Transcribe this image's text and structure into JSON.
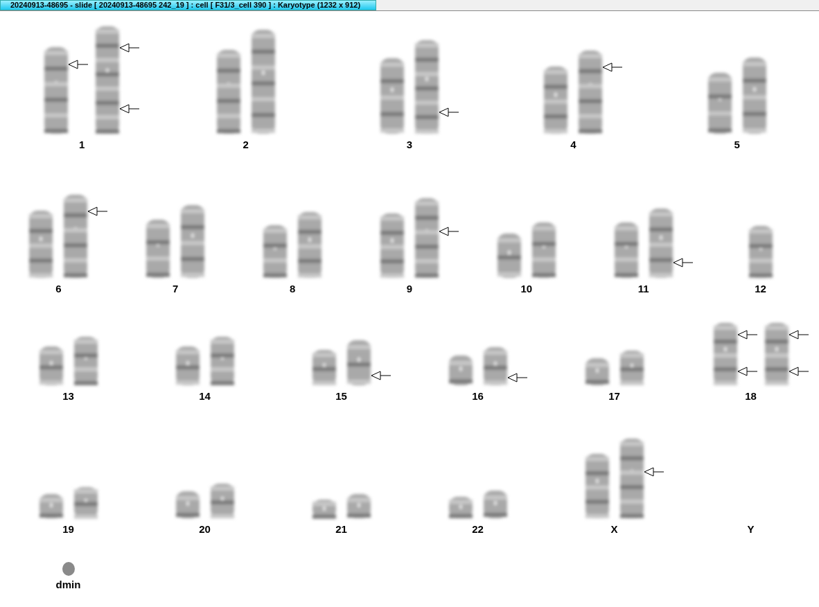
{
  "title_bar": {
    "title": "20240913-48695 - slide [ 20240913-48695 242_19 ] : cell [ F31/3_cell 390 ] : Karyotype  (1232 x 912)"
  },
  "rows": [
    {
      "groups": [
        {
          "label": "1",
          "chromosomes": [
            {
              "kind": "chromosome",
              "arrow_p": true,
              "arrow_cen": false,
              "arrow_q": false
            },
            {
              "kind": "chromosome",
              "arrow_p": true,
              "arrow_cen": false,
              "arrow_q": true
            }
          ]
        },
        {
          "label": "2",
          "chromosomes": [
            {
              "kind": "chromosome",
              "arrow_p": false,
              "arrow_cen": false,
              "arrow_q": false
            },
            {
              "kind": "chromosome",
              "arrow_p": false,
              "arrow_cen": false,
              "arrow_q": false
            }
          ]
        },
        {
          "label": "3",
          "chromosomes": [
            {
              "kind": "chromosome",
              "arrow_p": false,
              "arrow_cen": false,
              "arrow_q": false
            },
            {
              "kind": "chromosome",
              "arrow_p": false,
              "arrow_cen": false,
              "arrow_q": true
            }
          ]
        },
        {
          "label": "4",
          "chromosomes": [
            {
              "kind": "chromosome",
              "arrow_p": false,
              "arrow_cen": false,
              "arrow_q": false
            },
            {
              "kind": "chromosome",
              "arrow_p": true,
              "arrow_cen": false,
              "arrow_q": false
            }
          ]
        },
        {
          "label": "5",
          "chromosomes": [
            {
              "kind": "chromosome",
              "arrow_p": false,
              "arrow_cen": false,
              "arrow_q": false
            },
            {
              "kind": "chromosome",
              "arrow_p": false,
              "arrow_cen": false,
              "arrow_q": false
            }
          ]
        }
      ]
    },
    {
      "groups": [
        {
          "label": "6",
          "chromosomes": [
            {
              "kind": "chromosome",
              "arrow_p": false,
              "arrow_cen": false,
              "arrow_q": false
            },
            {
              "kind": "chromosome",
              "arrow_p": true,
              "arrow_cen": false,
              "arrow_q": false
            }
          ]
        },
        {
          "label": "7",
          "chromosomes": [
            {
              "kind": "chromosome",
              "arrow_p": false,
              "arrow_cen": false,
              "arrow_q": false
            },
            {
              "kind": "chromosome",
              "arrow_p": false,
              "arrow_cen": false,
              "arrow_q": false
            }
          ]
        },
        {
          "label": "8",
          "chromosomes": [
            {
              "kind": "chromosome",
              "arrow_p": false,
              "arrow_cen": false,
              "arrow_q": false
            },
            {
              "kind": "chromosome",
              "arrow_p": false,
              "arrow_cen": false,
              "arrow_q": false
            }
          ]
        },
        {
          "label": "9",
          "chromosomes": [
            {
              "kind": "chromosome",
              "arrow_p": false,
              "arrow_cen": false,
              "arrow_q": false
            },
            {
              "kind": "chromosome",
              "arrow_p": false,
              "arrow_cen": true,
              "arrow_q": false
            }
          ]
        },
        {
          "label": "10",
          "chromosomes": [
            {
              "kind": "chromosome",
              "arrow_p": false,
              "arrow_cen": false,
              "arrow_q": false
            },
            {
              "kind": "chromosome",
              "arrow_p": false,
              "arrow_cen": false,
              "arrow_q": false
            }
          ]
        },
        {
          "label": "11",
          "chromosomes": [
            {
              "kind": "chromosome",
              "arrow_p": false,
              "arrow_cen": false,
              "arrow_q": false
            },
            {
              "kind": "chromosome",
              "arrow_p": false,
              "arrow_cen": false,
              "arrow_q": true
            }
          ]
        },
        {
          "label": "12",
          "chromosomes": [
            {
              "kind": "chromosome",
              "arrow_p": false,
              "arrow_cen": false,
              "arrow_q": false
            }
          ]
        }
      ]
    },
    {
      "groups": [
        {
          "label": "13",
          "chromosomes": [
            {
              "kind": "chromosome",
              "arrow_p": false,
              "arrow_cen": false,
              "arrow_q": false
            },
            {
              "kind": "chromosome",
              "arrow_p": false,
              "arrow_cen": false,
              "arrow_q": false
            }
          ]
        },
        {
          "label": "14",
          "chromosomes": [
            {
              "kind": "chromosome",
              "arrow_p": false,
              "arrow_cen": false,
              "arrow_q": false
            },
            {
              "kind": "chromosome",
              "arrow_p": false,
              "arrow_cen": false,
              "arrow_q": false
            }
          ]
        },
        {
          "label": "15",
          "chromosomes": [
            {
              "kind": "chromosome",
              "arrow_p": false,
              "arrow_cen": false,
              "arrow_q": false
            },
            {
              "kind": "chromosome",
              "arrow_p": false,
              "arrow_cen": false,
              "arrow_q": true
            }
          ]
        },
        {
          "label": "16",
          "chromosomes": [
            {
              "kind": "chromosome",
              "arrow_p": false,
              "arrow_cen": false,
              "arrow_q": false
            },
            {
              "kind": "chromosome",
              "arrow_p": false,
              "arrow_cen": false,
              "arrow_q": true
            }
          ]
        },
        {
          "label": "17",
          "chromosomes": [
            {
              "kind": "chromosome",
              "arrow_p": false,
              "arrow_cen": false,
              "arrow_q": false
            },
            {
              "kind": "chromosome",
              "arrow_p": false,
              "arrow_cen": false,
              "arrow_q": false
            }
          ]
        },
        {
          "label": "18",
          "chromosomes": [
            {
              "kind": "chromosome",
              "arrow_p": true,
              "arrow_cen": false,
              "arrow_q": true
            },
            {
              "kind": "chromosome",
              "arrow_p": true,
              "arrow_cen": false,
              "arrow_q": true
            }
          ]
        }
      ]
    },
    {
      "groups": [
        {
          "label": "19",
          "chromosomes": [
            {
              "kind": "chromosome",
              "arrow_p": false,
              "arrow_cen": false,
              "arrow_q": false
            },
            {
              "kind": "chromosome",
              "arrow_p": false,
              "arrow_cen": false,
              "arrow_q": false
            }
          ]
        },
        {
          "label": "20",
          "chromosomes": [
            {
              "kind": "chromosome",
              "arrow_p": false,
              "arrow_cen": false,
              "arrow_q": false
            },
            {
              "kind": "chromosome",
              "arrow_p": false,
              "arrow_cen": false,
              "arrow_q": false
            }
          ]
        },
        {
          "label": "21",
          "chromosomes": [
            {
              "kind": "chromosome",
              "arrow_p": false,
              "arrow_cen": false,
              "arrow_q": false
            },
            {
              "kind": "chromosome",
              "arrow_p": false,
              "arrow_cen": false,
              "arrow_q": false
            }
          ]
        },
        {
          "label": "22",
          "chromosomes": [
            {
              "kind": "chromosome",
              "arrow_p": false,
              "arrow_cen": false,
              "arrow_q": false
            },
            {
              "kind": "chromosome",
              "arrow_p": false,
              "arrow_cen": false,
              "arrow_q": false
            }
          ]
        },
        {
          "label": "X",
          "chromosomes": [
            {
              "kind": "chromosome",
              "arrow_p": false,
              "arrow_cen": false,
              "arrow_q": false
            },
            {
              "kind": "chromosome",
              "arrow_p": false,
              "arrow_cen": true,
              "arrow_q": false
            }
          ]
        },
        {
          "label": "Y"
        }
      ]
    },
    {
      "groups": [
        {
          "label": "dmin",
          "chromosomes": [
            {
              "kind": "dmin"
            }
          ]
        }
      ]
    }
  ]
}
